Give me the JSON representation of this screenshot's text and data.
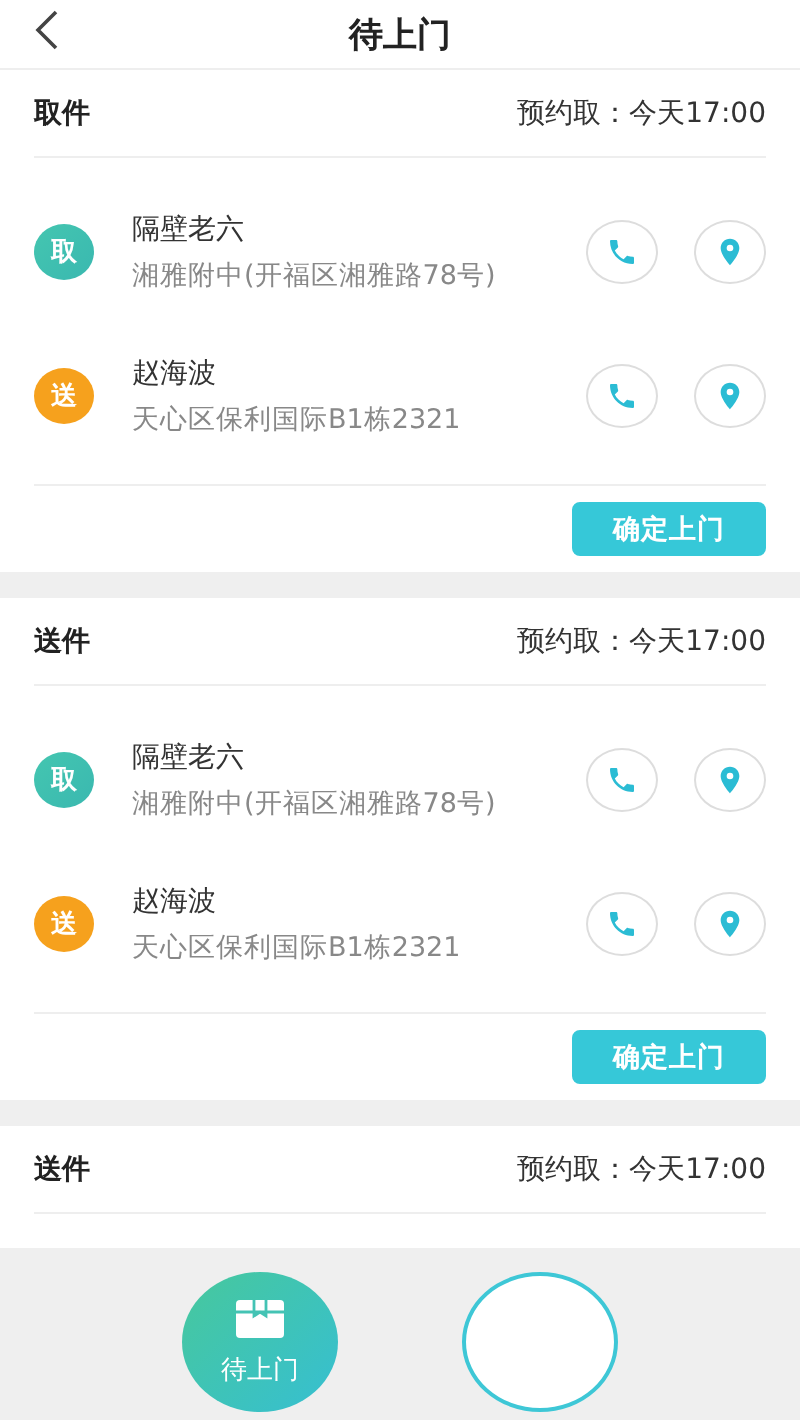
{
  "header": {
    "title": "待上门"
  },
  "orders": [
    {
      "type": "取件",
      "appointment": "预约取：今天17:00",
      "contacts": [
        {
          "kind": "pickup",
          "badge": "取",
          "name": "隔壁老六",
          "address": "湘雅附中(开福区湘雅路78号)"
        },
        {
          "kind": "delivery",
          "badge": "送",
          "name": "赵海波",
          "address": "天心区保利国际B1栋2321"
        }
      ],
      "action": "确定上门"
    },
    {
      "type": "送件",
      "appointment": "预约取：今天17:00",
      "contacts": [
        {
          "kind": "pickup",
          "badge": "取",
          "name": "隔壁老六",
          "address": "湘雅附中(开福区湘雅路78号)"
        },
        {
          "kind": "delivery",
          "badge": "送",
          "name": "赵海波",
          "address": "天心区保利国际B1栋2321"
        }
      ],
      "action": "确定上门"
    },
    {
      "type": "送件",
      "appointment": "预约取：今天17:00"
    }
  ],
  "nav": [
    {
      "label": "待上门",
      "selected": true
    },
    {
      "selected": false
    }
  ]
}
